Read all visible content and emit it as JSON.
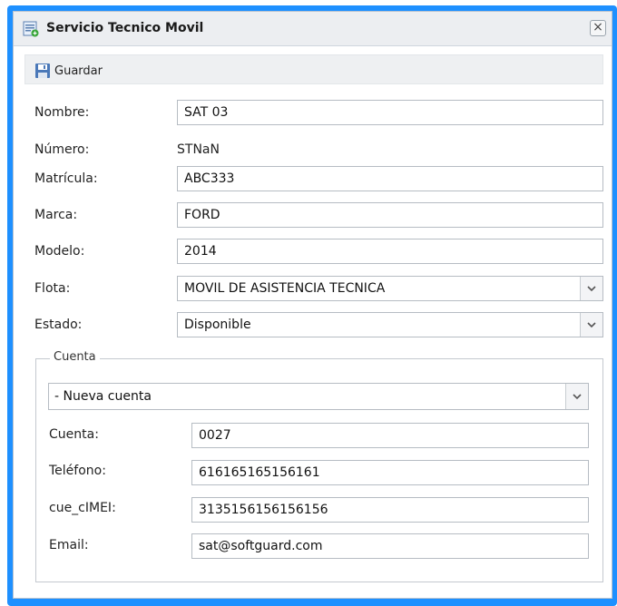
{
  "window": {
    "title": "Servicio Tecnico Movil",
    "close_label": "×"
  },
  "toolbar": {
    "save_label": "Guardar"
  },
  "form": {
    "nombre": {
      "label": "Nombre:",
      "value": "SAT 03"
    },
    "numero": {
      "label": "Número:",
      "value": "STNaN"
    },
    "matricula": {
      "label": "Matrícula:",
      "value": "ABC333"
    },
    "marca": {
      "label": "Marca:",
      "value": "FORD"
    },
    "modelo": {
      "label": "Modelo:",
      "value": "2014"
    },
    "flota": {
      "label": "Flota:",
      "value": "MOVIL DE ASISTENCIA TECNICA"
    },
    "estado": {
      "label": "Estado:",
      "value": "Disponible"
    }
  },
  "cuenta": {
    "legend": "Cuenta",
    "selector_value": "- Nueva cuenta",
    "cuenta": {
      "label": "Cuenta:",
      "value": "0027"
    },
    "telefono": {
      "label": "Teléfono:",
      "value": "616165165156161"
    },
    "imei": {
      "label": "cue_cIMEI:",
      "value": "3135156156156156"
    },
    "email": {
      "label": "Email:",
      "value": "sat@softguard.com"
    }
  }
}
